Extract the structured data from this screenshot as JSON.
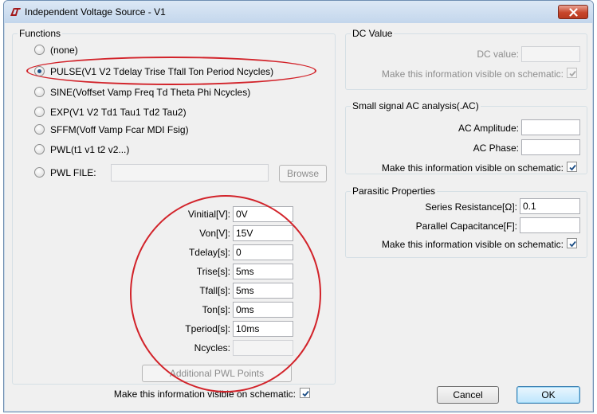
{
  "window": {
    "title": "Independent Voltage Source - V1"
  },
  "functions": {
    "legend": "Functions",
    "options": [
      {
        "label": "(none)",
        "selected": false
      },
      {
        "label": "PULSE(V1 V2 Tdelay Trise Tfall Ton Period Ncycles)",
        "selected": true
      },
      {
        "label": "SINE(Voffset Vamp Freq Td Theta Phi Ncycles)",
        "selected": false
      },
      {
        "label": "EXP(V1 V2 Td1 Tau1 Td2 Tau2)",
        "selected": false
      },
      {
        "label": "SFFM(Voff Vamp Fcar MDI Fsig)",
        "selected": false
      },
      {
        "label": "PWL(t1 v1 t2 v2...)",
        "selected": false
      },
      {
        "label": "PWL FILE:",
        "selected": false
      }
    ],
    "pwl_file_value": "",
    "browse_label": "Browse",
    "params": [
      {
        "label": "Vinitial[V]:",
        "value": "0V"
      },
      {
        "label": "Von[V]:",
        "value": "15V"
      },
      {
        "label": "Tdelay[s]:",
        "value": "0"
      },
      {
        "label": "Trise[s]:",
        "value": "5ms"
      },
      {
        "label": "Tfall[s]:",
        "value": "5ms"
      },
      {
        "label": "Ton[s]:",
        "value": "0ms"
      },
      {
        "label": "Tperiod[s]:",
        "value": "10ms"
      },
      {
        "label": "Ncycles:",
        "value": ""
      }
    ],
    "additional_pwl_label": "Additional PWL Points",
    "visible_label": "Make this information visible on schematic:",
    "visible_checked": true
  },
  "dc": {
    "legend": "DC Value",
    "dc_value_label": "DC value:",
    "dc_value": "",
    "visible_label": "Make this information visible on schematic:",
    "visible_checked": true
  },
  "ac": {
    "legend": "Small signal AC analysis(.AC)",
    "amplitude_label": "AC Amplitude:",
    "amplitude_value": "",
    "phase_label": "AC Phase:",
    "phase_value": "",
    "visible_label": "Make this information visible on schematic:",
    "visible_checked": true
  },
  "parasitic": {
    "legend": "Parasitic Properties",
    "series_label": "Series Resistance[Ω]:",
    "series_value": "0.1",
    "parallel_label": "Parallel Capacitance[F]:",
    "parallel_value": "",
    "visible_label": "Make this information visible on schematic:",
    "visible_checked": true
  },
  "buttons": {
    "cancel": "Cancel",
    "ok": "OK"
  },
  "colors": {
    "annotation": "#d2232a",
    "selected_radio": "#1c4e86",
    "titlebar": "#c3d6ec"
  },
  "icons": {
    "app": "ltspice-logo-icon",
    "close": "close-icon"
  }
}
